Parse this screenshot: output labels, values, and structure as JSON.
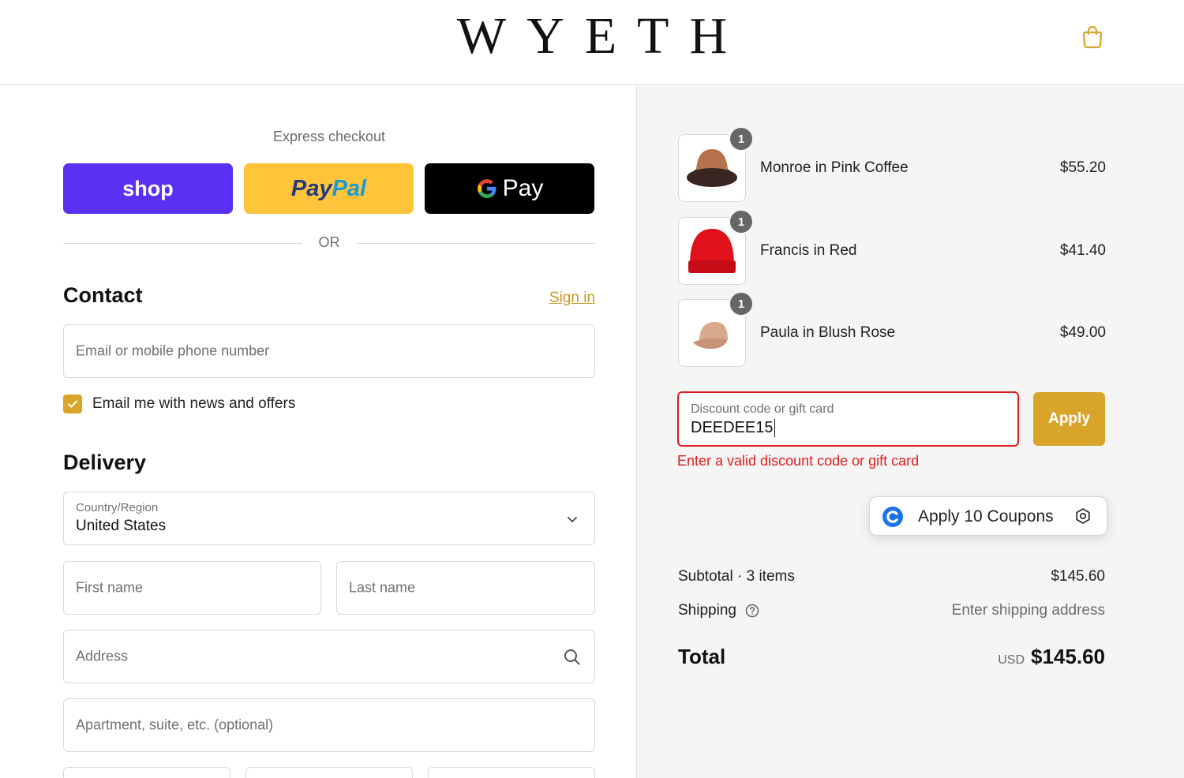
{
  "brand": "WYETH",
  "header": {
    "cart_icon": "shopping-bag-icon"
  },
  "express": {
    "label": "Express checkout",
    "shop_label": "shop",
    "paypal_part1": "Pay",
    "paypal_part2": "Pal",
    "gpay_label": "Pay",
    "or_label": "OR"
  },
  "contact": {
    "title": "Contact",
    "sign_in": "Sign in",
    "email_placeholder": "Email or mobile phone number",
    "newsletter_label": "Email me with news and offers",
    "newsletter_checked": true
  },
  "delivery": {
    "title": "Delivery",
    "country_label": "Country/Region",
    "country_value": "United States",
    "first_name_placeholder": "First name",
    "last_name_placeholder": "Last name",
    "address_placeholder": "Address",
    "apartment_placeholder": "Apartment, suite, etc. (optional)"
  },
  "order": {
    "items": [
      {
        "name": "Monroe in Pink Coffee",
        "price": "$55.20",
        "qty": "1"
      },
      {
        "name": "Francis in Red",
        "price": "$41.40",
        "qty": "1"
      },
      {
        "name": "Paula in Blush Rose",
        "price": "$49.00",
        "qty": "1"
      }
    ],
    "discount": {
      "label": "Discount code or gift card",
      "value": "DEEDEE15",
      "apply": "Apply",
      "error": "Enter a valid discount code or gift card"
    },
    "coupons": {
      "label": "Apply 10 Coupons"
    },
    "subtotal_label": "Subtotal · 3 items",
    "subtotal_value": "$145.60",
    "shipping_label": "Shipping",
    "shipping_value": "Enter shipping address",
    "total_label": "Total",
    "total_currency": "USD",
    "total_value": "$145.60"
  },
  "colors": {
    "accent": "#d8a42a",
    "shop_purple": "#5a31f4",
    "paypal_yellow": "#ffc439",
    "error_red": "#dd1d1d"
  }
}
